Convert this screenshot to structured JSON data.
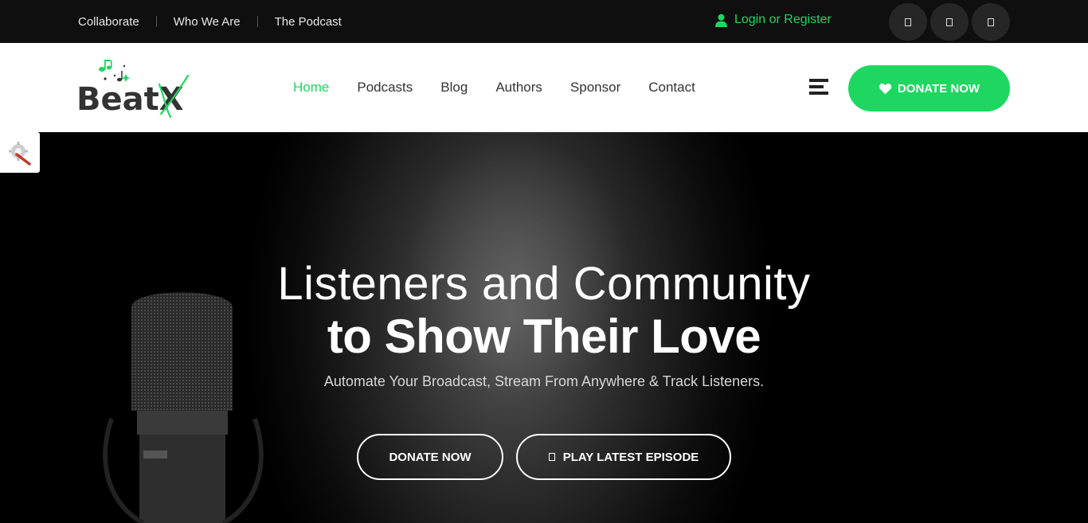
{
  "topbar": {
    "links": [
      "Collaborate",
      "Who We Are",
      "The Podcast"
    ],
    "login_label": "Login or Register",
    "social_icons": [
      "social-icon-1",
      "social-icon-2",
      "social-icon-3"
    ]
  },
  "header": {
    "logo_text": "BeatX",
    "nav": [
      "Home",
      "Podcasts",
      "Blog",
      "Authors",
      "Sponsor",
      "Contact"
    ],
    "active_nav": "Home",
    "donate_label": "DONATE NOW"
  },
  "hero": {
    "title_line1": "Listeners and Community",
    "title_line2": "to Show Their Love",
    "subtitle": "Automate Your Broadcast, Stream From Anywhere & Track Listeners.",
    "btn_donate": "DONATE NOW",
    "btn_play": "PLAY LATEST EPISODE"
  },
  "colors": {
    "accent": "#1ed760",
    "topbar_bg": "#0f0f0f",
    "header_bg": "#ffffff",
    "hero_bg": "#000000"
  }
}
